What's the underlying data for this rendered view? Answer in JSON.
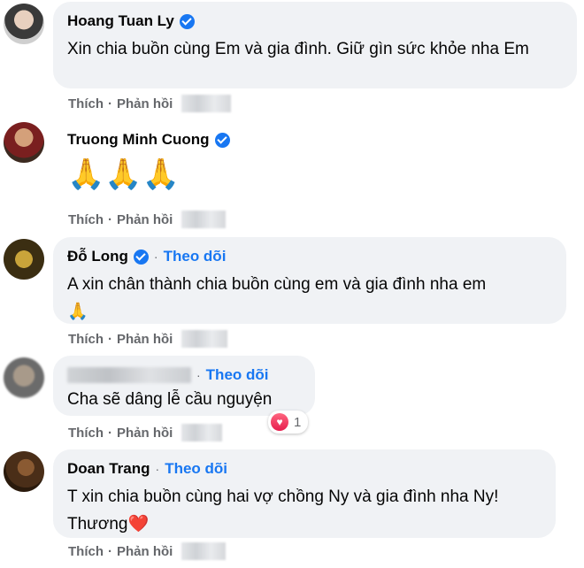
{
  "actions": {
    "like": "Thích",
    "reply": "Phản hồi",
    "separator": "·"
  },
  "follow_label": "Theo dõi",
  "comments": [
    {
      "author": "Hoang Tuan Ly",
      "verified": true,
      "text": "Xin chia buồn cùng Em và gia đình. Giữ gìn sức khỏe nha Em"
    },
    {
      "author": "Truong Minh Cuong",
      "verified": true,
      "text": "🙏🙏🙏"
    },
    {
      "author": "Đỗ Long",
      "verified": true,
      "follow": true,
      "text": "A xin chân thành chia buồn cùng em và gia đình nha em",
      "emoji": "🙏"
    },
    {
      "author": "",
      "follow": true,
      "text": "Cha sẽ dâng lễ cầu nguyện",
      "reaction": {
        "icon": "heart-icon",
        "count": "1"
      }
    },
    {
      "author": "Doan Trang",
      "follow": true,
      "text": "T xin chia buồn cùng hai vợ chồng Ny và gia đình nha Ny! Thương",
      "emoji": "❤️"
    }
  ],
  "colors": {
    "bubble": "#f0f2f5",
    "link": "#1877f2",
    "meta": "#65676b"
  }
}
